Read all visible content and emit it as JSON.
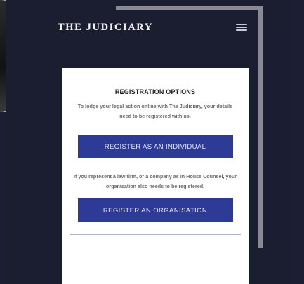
{
  "header": {
    "brand": "THE JUDICIARY",
    "menu_icon": "hamburger-icon"
  },
  "card": {
    "title": "REGISTRATION OPTIONS",
    "intro": "To lodge your legal action online with The Judiciary, your details need to be registered with us.",
    "individual_button": "REGISTER AS AN INDIVIDUAL",
    "organisation_note": "If you represent a law firm, or a company as In House Counsel, your organisation also needs to be registered.",
    "organisation_button": "REGISTER AN ORGANISATION"
  },
  "colors": {
    "background": "#1b1e31",
    "button": "#2d3a96",
    "card": "#ffffff"
  }
}
